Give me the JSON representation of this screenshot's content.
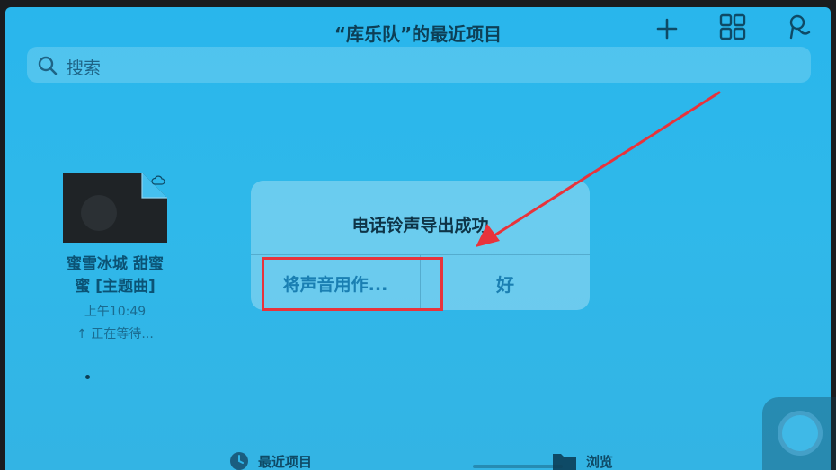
{
  "nav": {
    "title": "“库乐队”的最近项目",
    "add_icon": "plus-icon",
    "view_icon": "grid-icon",
    "action_icon": "microphone-icon"
  },
  "search": {
    "placeholder": "搜索",
    "icon": "search-icon"
  },
  "file": {
    "name_line1": "蜜雪冰城 甜蜜",
    "name_line2": "蜜 [主题曲]",
    "time": "上午10:49",
    "status": "↑ 正在等待..."
  },
  "dialog": {
    "title": "电话铃声导出成功",
    "use_sound_label": "将声音用作...",
    "ok_label": "好"
  },
  "tabbar": {
    "recents_label": "最近项目",
    "browse_label": "浏览"
  },
  "colors": {
    "background": "#29b6ec",
    "annotation": "#e8333b",
    "button_text": "#1a7fb2"
  }
}
